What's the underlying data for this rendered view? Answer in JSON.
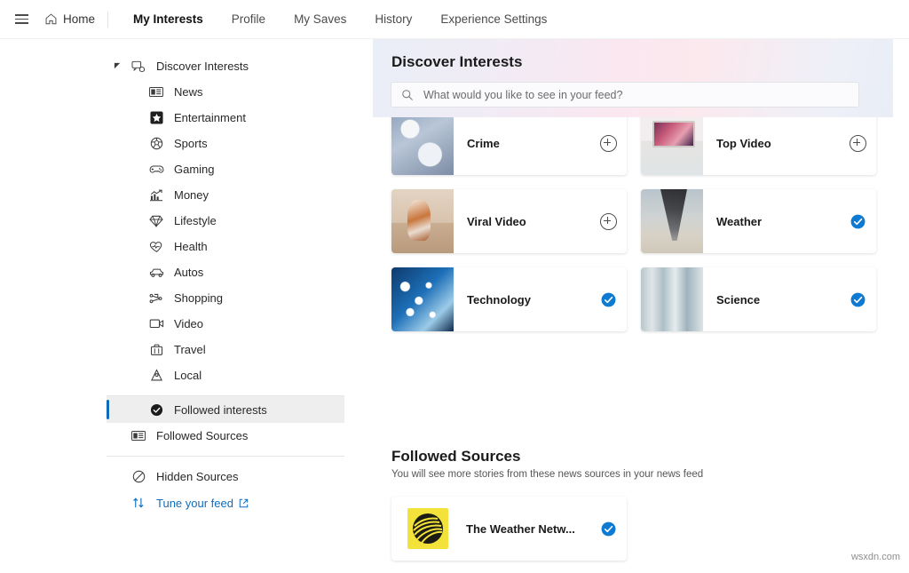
{
  "topnav": {
    "menu_icon": "hamburger-icon",
    "home_label": "Home",
    "home_icon": "home-icon",
    "tabs": [
      {
        "label": "My Interests",
        "active": true
      },
      {
        "label": "Profile",
        "active": false
      },
      {
        "label": "My Saves",
        "active": false
      },
      {
        "label": "History",
        "active": false
      },
      {
        "label": "Experience Settings",
        "active": false
      }
    ]
  },
  "sidebar": {
    "root": {
      "label": "Discover Interests",
      "icon": "discover-interests-icon",
      "expanded": true
    },
    "categories": [
      {
        "label": "News",
        "icon": "news-icon"
      },
      {
        "label": "Entertainment",
        "icon": "star-icon"
      },
      {
        "label": "Sports",
        "icon": "soccer-ball-icon"
      },
      {
        "label": "Gaming",
        "icon": "gamepad-icon"
      },
      {
        "label": "Money",
        "icon": "chart-up-icon"
      },
      {
        "label": "Lifestyle",
        "icon": "diamond-icon"
      },
      {
        "label": "Health",
        "icon": "heart-icon"
      },
      {
        "label": "Autos",
        "icon": "car-icon"
      },
      {
        "label": "Shopping",
        "icon": "tag-network-icon"
      },
      {
        "label": "Video",
        "icon": "video-icon"
      },
      {
        "label": "Travel",
        "icon": "suitcase-icon"
      },
      {
        "label": "Local",
        "icon": "location-pin-icon"
      }
    ],
    "followed_interests": {
      "label": "Followed interests",
      "icon": "check-circle-filled-icon",
      "selected": true
    },
    "followed_sources": {
      "label": "Followed Sources",
      "icon": "newspaper-icon"
    },
    "hidden_sources": {
      "label": "Hidden Sources",
      "icon": "block-icon"
    },
    "tune_feed": {
      "label": "Tune your feed",
      "icon": "sort-arrows-icon",
      "external_icon": "external-link-icon"
    },
    "accent_color": "#0f6cbd",
    "selected_bg": "#eeeeee"
  },
  "discover_panel": {
    "title": "Discover Interests",
    "search": {
      "placeholder": "What would you like to see in your feed?",
      "value": "",
      "icon": "search-icon"
    }
  },
  "interest_cards": {
    "partial_row": [
      {
        "title": "",
        "thumb": "t-santa",
        "state": "partial"
      },
      {
        "title": "",
        "thumb": "t-autumn",
        "state": "partial"
      }
    ],
    "rows": [
      [
        {
          "title": "Crime",
          "thumb": "t-crime",
          "followed": false,
          "action_icon": "plus-circle-icon"
        },
        {
          "title": "Top Video",
          "thumb": "t-topvideo",
          "followed": false,
          "action_icon": "plus-circle-icon"
        }
      ],
      [
        {
          "title": "Viral Video",
          "thumb": "t-viral",
          "followed": false,
          "action_icon": "plus-circle-icon"
        },
        {
          "title": "Weather",
          "thumb": "t-weather",
          "followed": true,
          "action_icon": "check-circle-filled-icon"
        }
      ],
      [
        {
          "title": "Technology",
          "thumb": "t-tech",
          "followed": true,
          "action_icon": "check-circle-filled-icon"
        },
        {
          "title": "Science",
          "thumb": "t-science",
          "followed": true,
          "action_icon": "check-circle-filled-icon"
        }
      ]
    ]
  },
  "followed_sources_section": {
    "title": "Followed Sources",
    "subtitle": "You will see more stories from these news sources in your news feed",
    "sources": [
      {
        "name": "The Weather Netw...",
        "followed": true,
        "logo": "weather-network-logo",
        "action_icon": "check-circle-filled-icon"
      }
    ]
  },
  "watermark": "wsxdn.com",
  "colors": {
    "accent_blue": "#0f6cbd",
    "check_blue": "#0f7ad1",
    "text_primary": "#1b1b1b",
    "text_secondary": "#555555"
  }
}
